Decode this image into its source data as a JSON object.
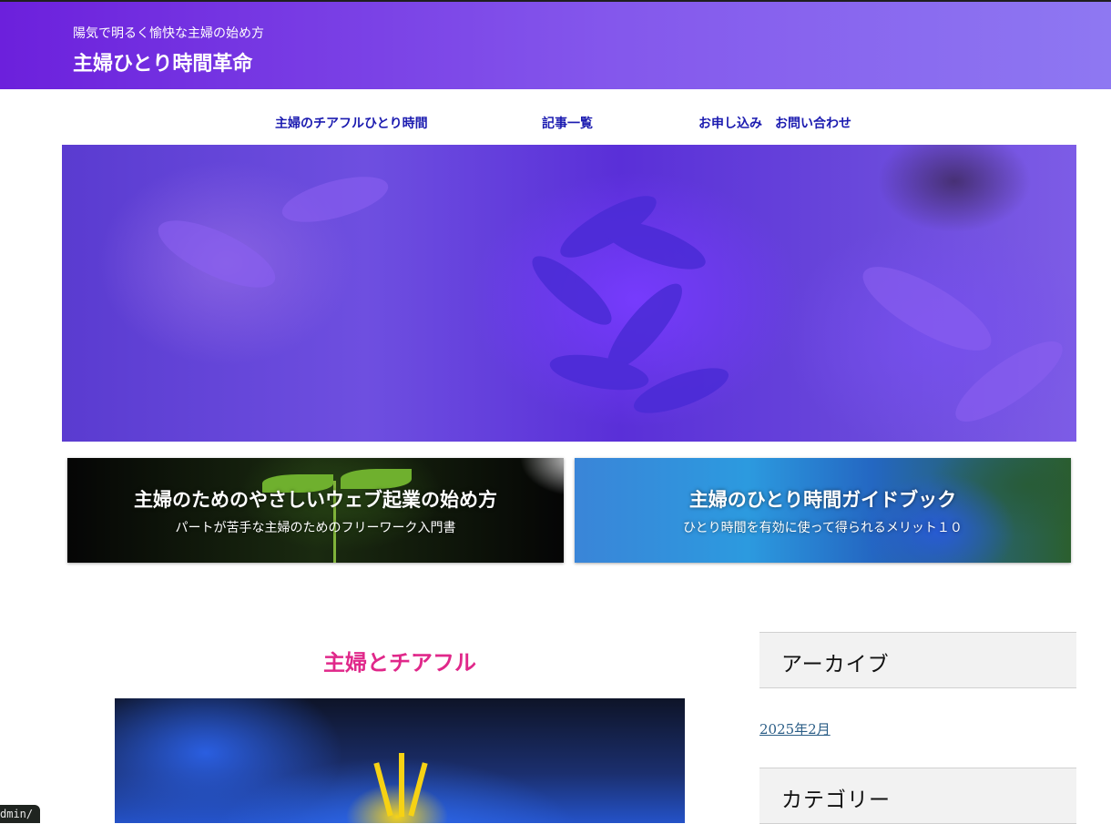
{
  "header": {
    "tagline": "陽気で明るく愉快な主婦の始め方",
    "site_title": "主婦ひとり時間革命"
  },
  "nav": {
    "items": [
      {
        "label": "主婦のチアフルひとり時間"
      },
      {
        "label": "記事一覧"
      },
      {
        "label": "お申し込み　お問い合わせ"
      }
    ]
  },
  "banners": [
    {
      "title": "主婦のためのやさしいウェブ起業の始め方",
      "subtitle": "パートが苦手な主婦のためのフリーワーク入門書"
    },
    {
      "title": "主婦のひとり時間ガイドブック",
      "subtitle": "ひとり時間を有効に使って得られるメリット１０"
    }
  ],
  "post": {
    "title": "主婦とチアフル"
  },
  "sidebar": {
    "archive_title": "アーカイブ",
    "archive_items": [
      "2025年2月"
    ],
    "category_title": "カテゴリー"
  },
  "status_bar": {
    "url_fragment": "dmin/"
  },
  "colors": {
    "header_start": "#6c20dc",
    "header_end": "#8e78f2",
    "nav_link": "#1b1bb0",
    "post_title": "#e0288a",
    "archive_link": "#2a5d86"
  }
}
